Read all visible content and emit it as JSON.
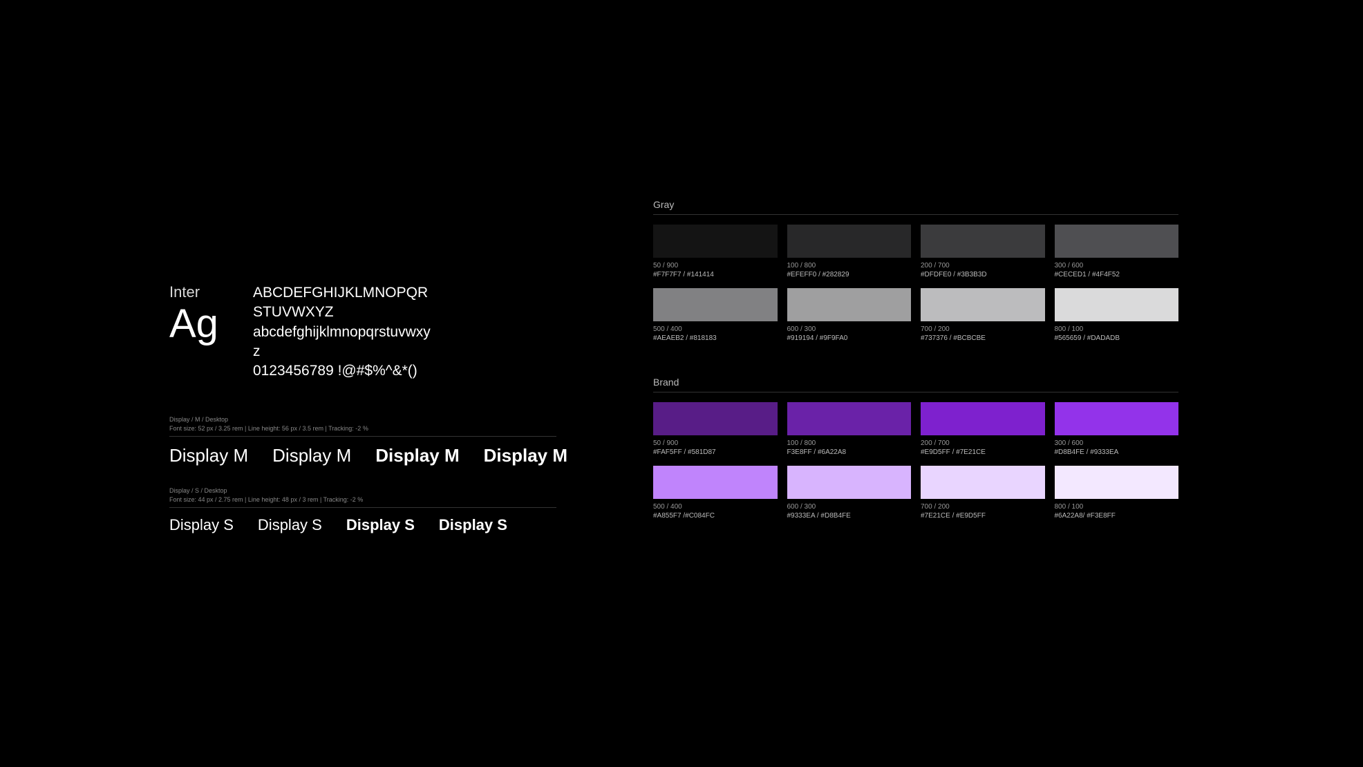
{
  "typography": {
    "font_name": "Inter",
    "font_sample": "Ag",
    "charset_upper": "ABCDEFGHIJKLMNOPQRSTUVWXYZ",
    "charset_lower": "abcdefghijklmnopqrstuvwxyz",
    "charset_numsym": "0123456789 !@#$%^&*()",
    "display_m": {
      "breadcrumb": "Display  /  M /  Desktop",
      "meta": "Font size: 52 px / 3.25 rem   |   Line height: 56 px / 3.5 rem   |   Tracking: -2 %",
      "weights": [
        "Display M",
        "Display M",
        "Display M",
        "Display M"
      ]
    },
    "display_s": {
      "breadcrumb": "Display  /  S /  Desktop",
      "meta": "Font size: 44 px / 2.75 rem   |   Line height: 48 px / 3 rem   |   Tracking: -2 %",
      "weights": [
        "Display S",
        "Display S",
        "Display S",
        "Display S"
      ]
    }
  },
  "palettes": [
    {
      "name": "Gray",
      "swatches": [
        {
          "label": "50 / 900",
          "hex": "#F7F7F7 / #141414",
          "color": "#141414"
        },
        {
          "label": "100 / 800",
          "hex": "#EFEFF0 / #282829",
          "color": "#282829"
        },
        {
          "label": "200 / 700",
          "hex": "#DFDFE0 / #3B3B3D",
          "color": "#3B3B3D"
        },
        {
          "label": "300 / 600",
          "hex": "#CECED1 / #4F4F52",
          "color": "#4F4F52"
        },
        {
          "label": "500 / 400",
          "hex": "#AEAEB2 / #818183",
          "color": "#818183"
        },
        {
          "label": "600 / 300",
          "hex": "#919194 / #9F9FA0",
          "color": "#9F9FA0"
        },
        {
          "label": "700 / 200",
          "hex": "#737376 / #BCBCBE",
          "color": "#BCBCBE"
        },
        {
          "label": "800 / 100",
          "hex": "#565659 / #DADADB",
          "color": "#DADADB"
        }
      ]
    },
    {
      "name": "Brand",
      "swatches": [
        {
          "label": "50 / 900",
          "hex": "#FAF5FF / #581D87",
          "color": "#581D87"
        },
        {
          "label": "100 / 800",
          "hex": "F3E8FF / #6A22A8",
          "color": "#6A22A8"
        },
        {
          "label": "200 / 700",
          "hex": "#E9D5FF / #7E21CE",
          "color": "#7E21CE"
        },
        {
          "label": "300 / 600",
          "hex": "#D8B4FE / #9333EA",
          "color": "#9333EA"
        },
        {
          "label": "500 / 400",
          "hex": "#A855F7 /#C084FC",
          "color": "#C084FC"
        },
        {
          "label": "600 / 300",
          "hex": "#9333EA / #D8B4FE",
          "color": "#D8B4FE"
        },
        {
          "label": "700 / 200",
          "hex": "#7E21CE / #E9D5FF",
          "color": "#E9D5FF"
        },
        {
          "label": "800 / 100",
          "hex": "#6A22A8/ #F3E8FF",
          "color": "#F3E8FF"
        }
      ]
    }
  ]
}
